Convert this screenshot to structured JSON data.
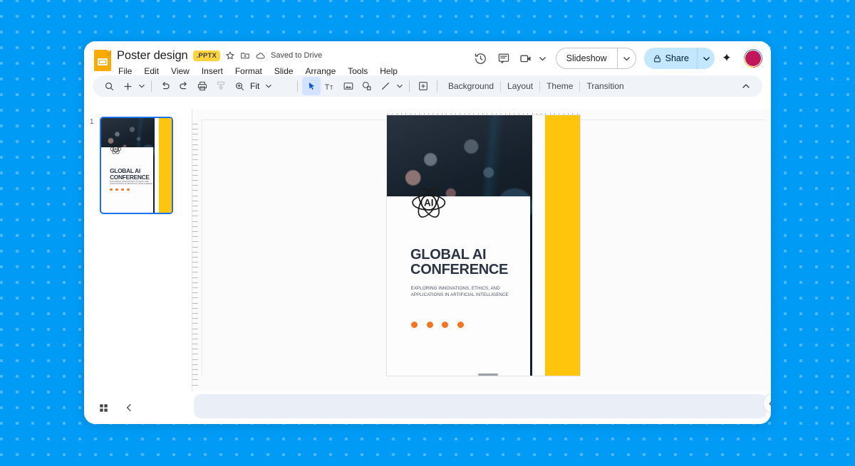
{
  "header": {
    "doc_icon": "slides-file-icon",
    "title": "Poster design",
    "format_badge": ".PPTX",
    "star_icon": "star-icon",
    "move_icon": "move-to-folder-icon",
    "cloud_icon": "cloud-saved-icon",
    "save_status": "Saved to Drive",
    "menus": [
      {
        "label": "File"
      },
      {
        "label": "Edit"
      },
      {
        "label": "View"
      },
      {
        "label": "Insert"
      },
      {
        "label": "Format"
      },
      {
        "label": "Slide"
      },
      {
        "label": "Arrange"
      },
      {
        "label": "Tools"
      },
      {
        "label": "Help"
      }
    ],
    "actions": {
      "history_icon": "version-history-icon",
      "comment_icon": "comment-icon",
      "meet_icon": "video-camera-icon",
      "slideshow_label": "Slideshow",
      "share_label": "Share",
      "share_lock_icon": "lock-icon",
      "gemini_icon": "gemini-sparkle-icon",
      "avatar": "user-avatar"
    }
  },
  "toolbar": {
    "search_icon": "search-icon",
    "new_slide_icon": "plus-icon",
    "undo_icon": "undo-icon",
    "redo_icon": "redo-icon",
    "print_icon": "print-icon",
    "paint_format_icon": "paint-format-icon",
    "zoom_icon": "zoom-icon",
    "zoom_value": "Fit",
    "select_icon": "cursor-select-icon",
    "textbox_icon": "text-box-icon",
    "image_icon": "insert-image-icon",
    "shape_icon": "insert-shape-icon",
    "line_icon": "insert-line-icon",
    "comment_add_icon": "add-comment-icon",
    "menu_buttons": [
      {
        "label": "Background"
      },
      {
        "label": "Layout"
      },
      {
        "label": "Theme"
      },
      {
        "label": "Transition"
      }
    ],
    "collapse_icon": "chevron-up-icon"
  },
  "filmstrip": {
    "slides": [
      {
        "number": "1"
      }
    ]
  },
  "poster": {
    "logo_text": "AI",
    "title_line1": "GLOBAL AI",
    "title_line2": "CONFERENCE",
    "subtitle_line1": "EXPLORING INNOVATIONS, ETHICS, AND",
    "subtitle_line2": "APPLICATIONS IN ARTIFICIAL INTELLIGENCE",
    "dot_count": 4,
    "colors": {
      "accent_yellow": "#ffc40c",
      "dot_orange": "#f4741f",
      "title_navy": "#2b3445",
      "card_white": "#fdfdfd"
    }
  },
  "bottom": {
    "grid_view_icon": "grid-view-icon",
    "collapse_filmstrip_icon": "chevron-left-icon",
    "notes_placeholder": "",
    "expand_panel_icon": "chevron-left-icon"
  },
  "theme": {
    "page_background": "#009bf5",
    "accent_blue": "#1a73e8",
    "share_blue": "#c2e7ff",
    "toolbar_grey": "#f0f4f9"
  }
}
